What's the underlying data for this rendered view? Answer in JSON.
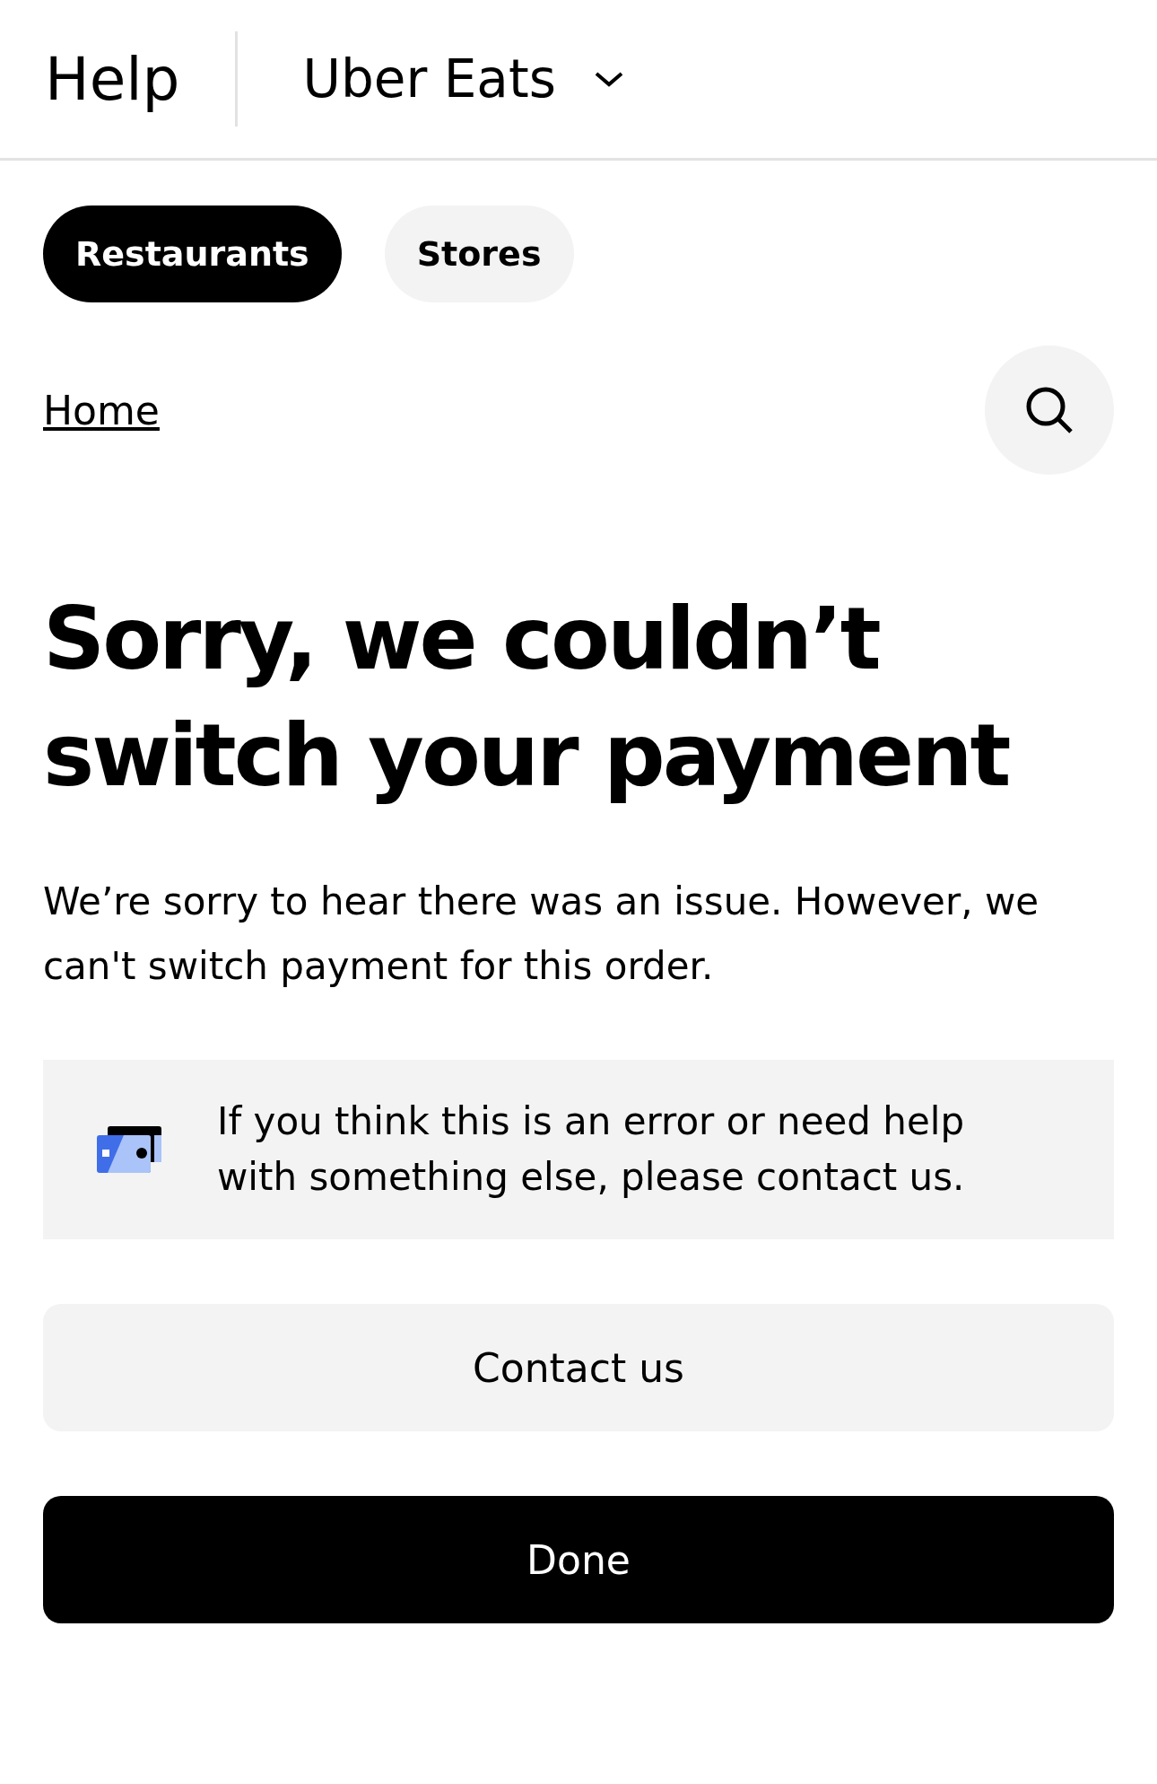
{
  "header": {
    "title": "Help",
    "product": "Uber Eats"
  },
  "tabs": [
    {
      "label": "Restaurants",
      "selected": true
    },
    {
      "label": "Stores",
      "selected": false
    }
  ],
  "breadcrumb": "Home",
  "heading": "Sorry, we couldn’t switch your payment",
  "message": "We’re sorry to hear there was an issue. However, we can't switch payment for this order.",
  "notice": "If you think this is an error or need help with something else, please contact us.",
  "buttons": [
    {
      "label": "Contact us",
      "kind": "secondary"
    },
    {
      "label": "Done",
      "kind": "primary"
    }
  ]
}
